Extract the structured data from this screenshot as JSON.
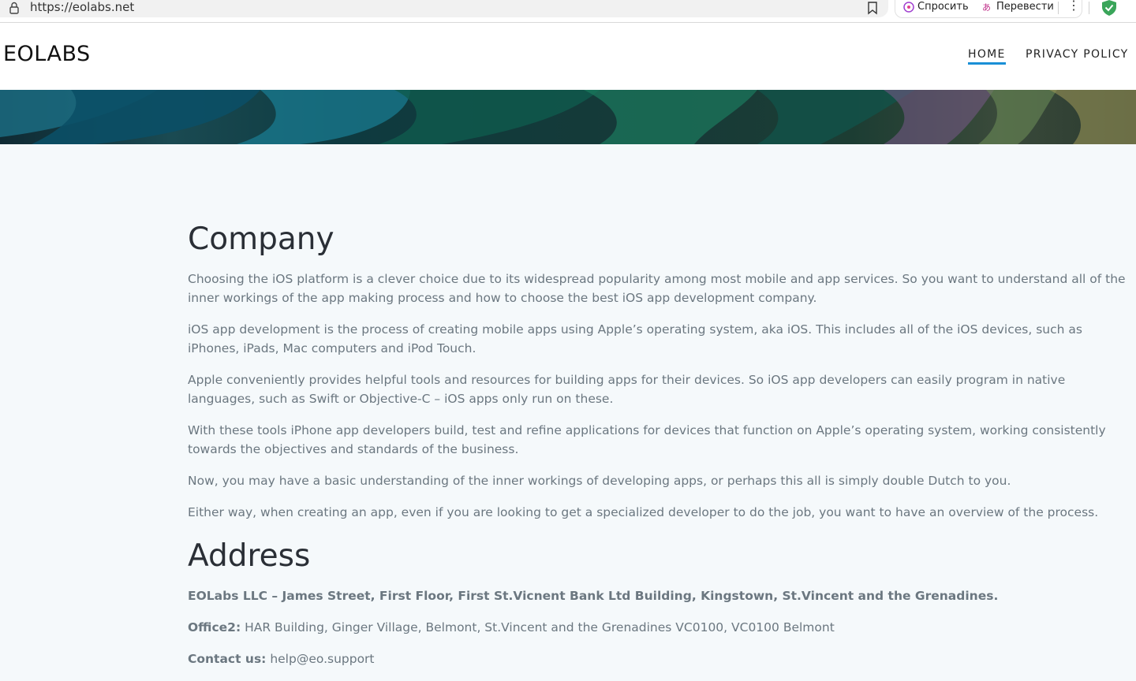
{
  "browser": {
    "url": "https://eolabs.net",
    "ext_ask_label": "Спросить",
    "ext_translate_label": "Перевести",
    "more_label": "⋮"
  },
  "site": {
    "logo": "EOLABS",
    "nav": [
      {
        "label": "HOME",
        "active": true
      },
      {
        "label": "PRIVACY POLICY",
        "active": false
      }
    ],
    "accent_color": "#1a8fd6"
  },
  "company": {
    "heading": "Company",
    "paragraphs": [
      "Choosing the iOS platform is a clever choice due to its widespread popularity among most mobile and app services. So you want to understand all of the inner workings of the app making process and how to choose the best iOS app development company.",
      "iOS app development is the process of creating mobile apps using Apple’s operating system, aka iOS. This includes all of the iOS devices, such as iPhones, iPads, Mac computers and iPod Touch.",
      "Apple conveniently provides helpful tools and resources for building apps for their devices. So iOS app developers can easily program in native languages, such as Swift or Objective-C – iOS apps only run on these.",
      "With these tools iPhone app developers build, test and refine applications for devices that function on Apple’s operating system, working consistently towards the objectives and standards of the business.",
      "Now, you may have a basic understanding of the inner workings of developing apps, or perhaps this all is simply double Dutch to you.",
      "Either way, when creating an app, even if you are looking to get a specialized developer to do the job, you want to have an overview of the process."
    ]
  },
  "address": {
    "heading": "Address",
    "main_line": "EOLabs LLC – James Street, First Floor, First St.Vicnent Bank Ltd Building, Kingstown, St.Vincent and the Grenadines.",
    "office2_label": "Office2:",
    "office2_value": " HAR Building, Ginger Village, Belmont, St.Vincent and the Grenadines VC0100, VC0100 Belmont",
    "contact_label": "Contact us:",
    "contact_value": " help@eo.support"
  }
}
